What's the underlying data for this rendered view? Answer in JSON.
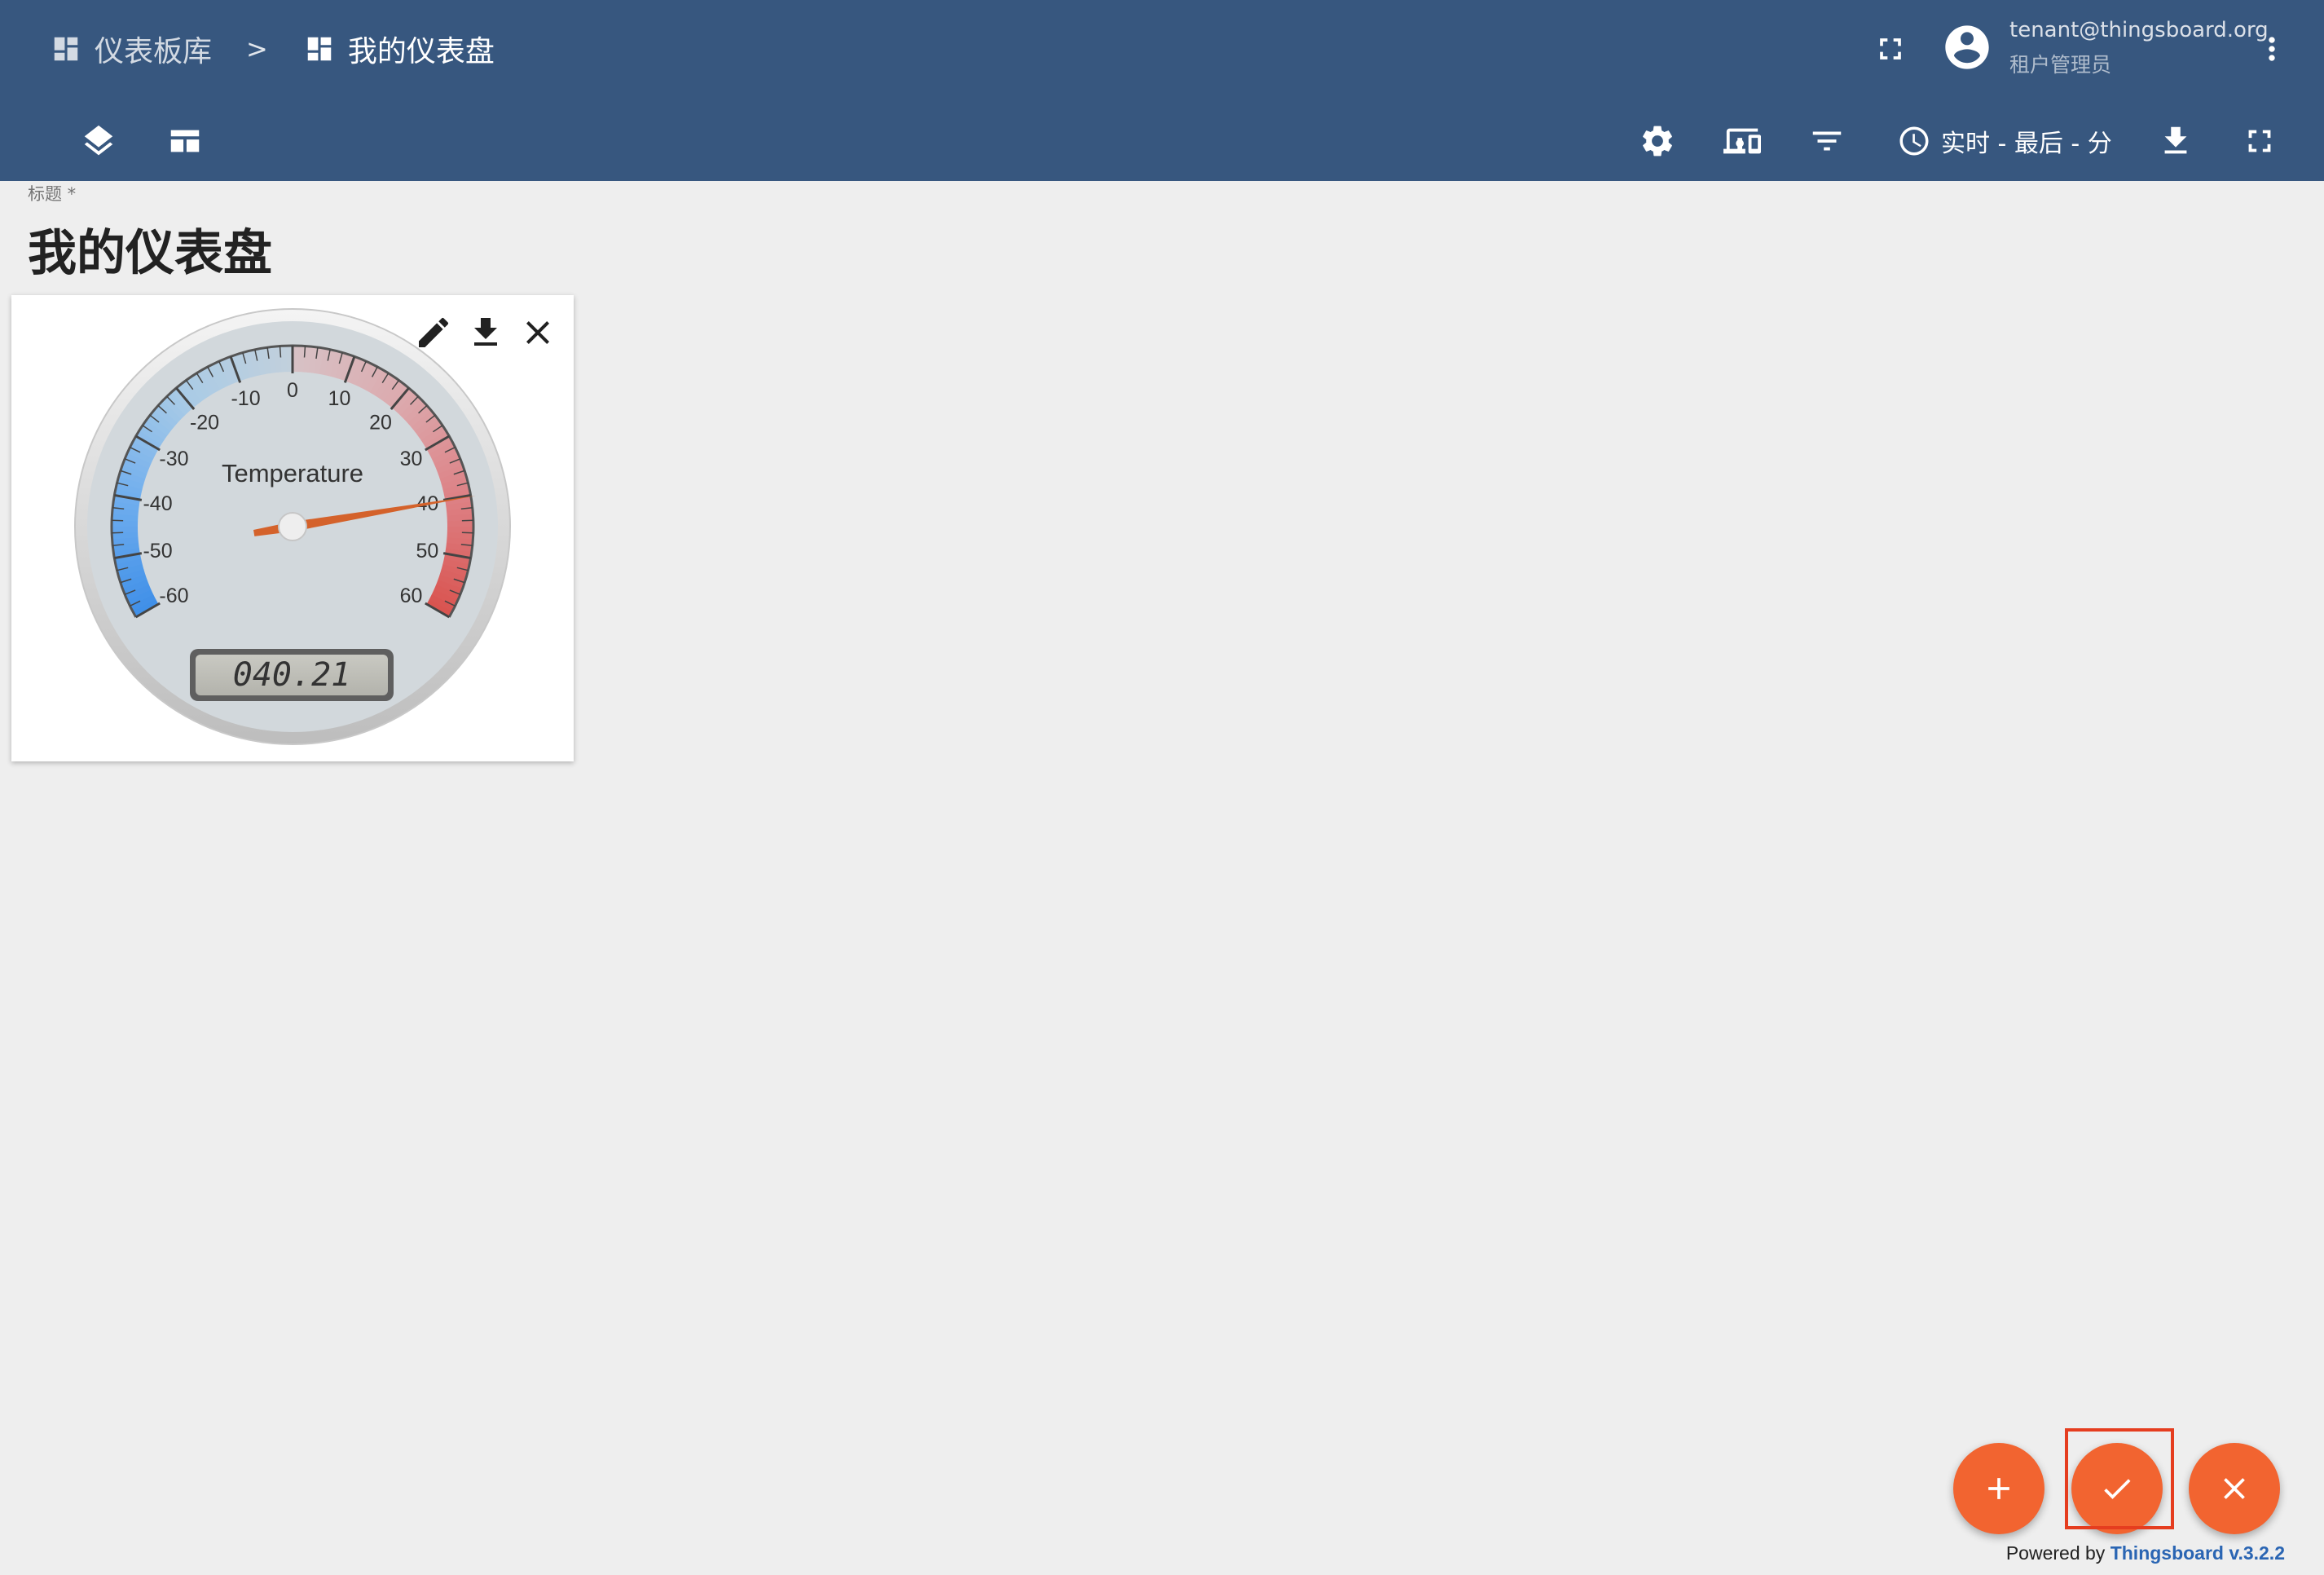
{
  "breadcrumb": {
    "library_label": "仪表板库",
    "separator": ">",
    "current_label": "我的仪表盘"
  },
  "user": {
    "email": "tenant@thingsboard.org",
    "role": "租户管理员"
  },
  "toolbar": {
    "time_window": "实时 - 最后 - 分",
    "icons": [
      "layers-icon",
      "layouts-icon",
      "settings-icon",
      "devices-icon",
      "filter-icon",
      "clock-icon",
      "download-icon",
      "fullscreen-icon"
    ]
  },
  "title_field": {
    "label": "标题 *",
    "value": "我的仪表盘"
  },
  "gauge": {
    "title": "Temperature",
    "value": 40.21,
    "lcd_value": "040.21",
    "min": -60,
    "max": 60,
    "tick_labels": [
      "-60",
      "-50",
      "-40",
      "-30",
      "-20",
      "-10",
      "0",
      "10",
      "20",
      "30",
      "40",
      "50",
      "60"
    ],
    "needle_color": "#d4622b"
  },
  "fabs": {
    "add_icon": "plus-icon",
    "apply_icon": "check-icon",
    "cancel_icon": "close-icon",
    "accent": "#f26430"
  },
  "footer": {
    "powered_prefix": "Powered by",
    "powered_link": "Thingsboard v.3.2.2"
  }
}
